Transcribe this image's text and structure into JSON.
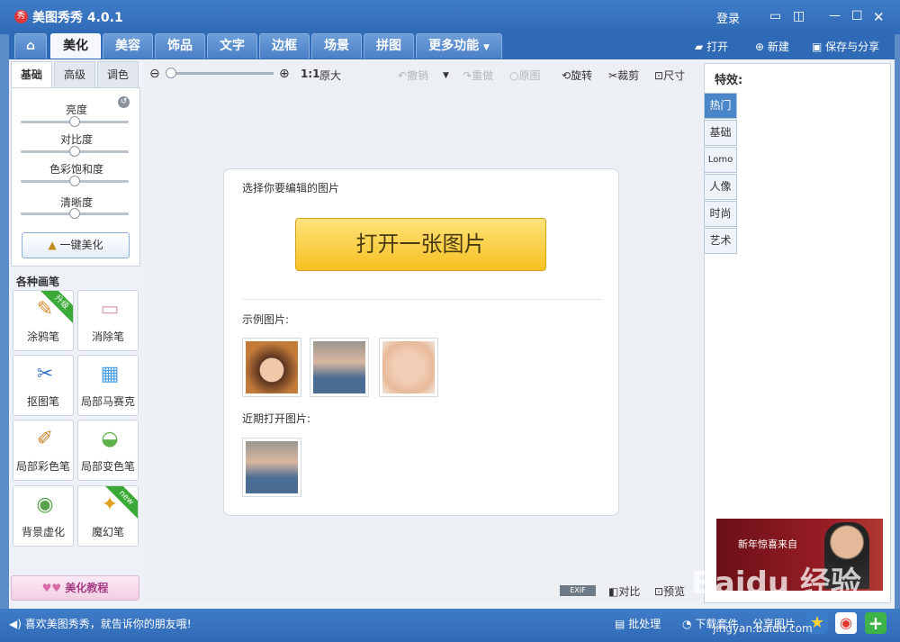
{
  "app": {
    "title": "美图秀秀 4.0.1",
    "logo_text": "秀",
    "login": "登录"
  },
  "nav": {
    "tabs": [
      "美化",
      "美容",
      "饰品",
      "文字",
      "边框",
      "场景",
      "拼图",
      "更多功能"
    ],
    "open": "打开",
    "new": "新建",
    "save_share": "保存与分享"
  },
  "left": {
    "subtabs": [
      "基础",
      "高级",
      "调色"
    ],
    "sliders": [
      {
        "label": "亮度",
        "value": 0.5
      },
      {
        "label": "对比度",
        "value": 0.5
      },
      {
        "label": "色彩饱和度",
        "value": 0.5
      },
      {
        "label": "清晰度",
        "value": 0.5
      }
    ],
    "auto_beautify": "一键美化",
    "brushes_title": "各种画笔",
    "tools": [
      {
        "label": "涂鸦笔",
        "icon": "✎",
        "badge": "升级"
      },
      {
        "label": "消除笔",
        "icon": "▭",
        "badge": ""
      },
      {
        "label": "抠图笔",
        "icon": "✂",
        "badge": ""
      },
      {
        "label": "局部马赛克",
        "icon": "▦",
        "badge": ""
      },
      {
        "label": "局部彩色笔",
        "icon": "✐",
        "badge": ""
      },
      {
        "label": "局部变色笔",
        "icon": "◒",
        "badge": ""
      },
      {
        "label": "背景虚化",
        "icon": "◉",
        "badge": ""
      },
      {
        "label": "魔幻笔",
        "icon": "✦",
        "badge": "new"
      }
    ],
    "tutorial": "美化教程"
  },
  "canvas": {
    "zoom_ratio": "1:1",
    "original_size": "原大",
    "undo": "撤销",
    "redo": "重做",
    "original": "原图",
    "rotate": "旋转",
    "crop": "裁剪",
    "resize": "尺寸",
    "choose_title": "选择你要编辑的图片",
    "open_button": "打开一张图片",
    "samples_label": "示例图片:",
    "recent_label": "近期打开图片:",
    "exif": "EXIF",
    "compare": "对比",
    "preview": "预览"
  },
  "right": {
    "title": "特效:",
    "tabs": [
      "热门",
      "基础",
      "Lomo",
      "人像",
      "时尚",
      "艺术"
    ],
    "ad_text": "新年惊喜来自"
  },
  "status": {
    "left_text": "喜欢美图秀秀，就告诉你的朋友哦!",
    "batch": "批处理",
    "download": "下载套件",
    "share": "分享图片"
  },
  "watermark": {
    "text": "Baidu 经验",
    "url": "jingyan.baidu.com"
  },
  "colors": {
    "accent": "#2f6ab6",
    "open_button": "#f6c022",
    "fx_active": "#4a86c8"
  }
}
